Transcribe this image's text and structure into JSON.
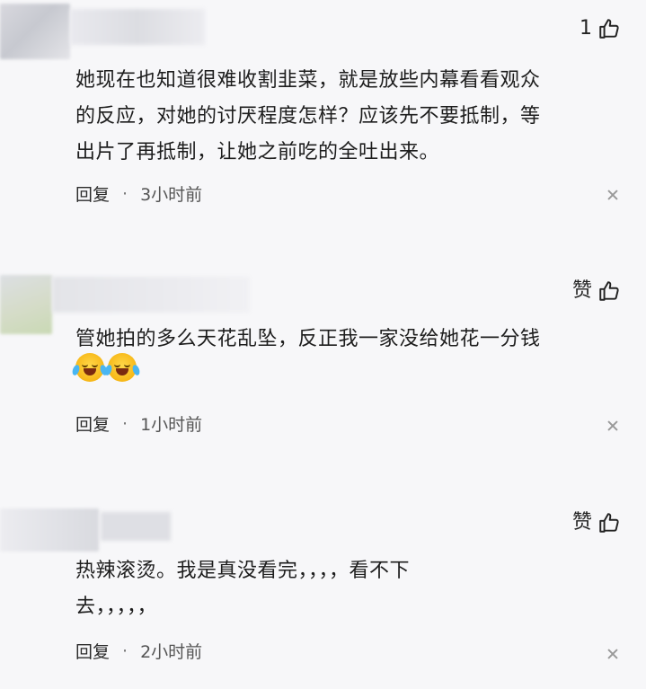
{
  "comments": [
    {
      "like_label": "1",
      "lines": [
        "她现在也知道很难收割韭菜，就是放些内幕看看观众",
        "的反应，对她的讨厌程度怎样？应该先不要抵制，等",
        "出片了再抵制，让她之前吃的全吐出来。"
      ],
      "reply_label": "回复",
      "separator": "·",
      "time": "3小时前"
    },
    {
      "like_label": "赞",
      "lines": [
        "管她拍的多么天花乱坠，反正我一家没给她花一分钱"
      ],
      "emojis": [
        "crying-laughing-emoji",
        "crying-laughing-emoji"
      ],
      "reply_label": "回复",
      "separator": "·",
      "time": "1小时前"
    },
    {
      "like_label": "赞",
      "lines": [
        "热辣滚烫。我是真没看完，，，，看不下",
        "去，，，，，"
      ],
      "reply_label": "回复",
      "separator": "·",
      "time": "2小时前"
    }
  ],
  "icons": {
    "like": "thumbs-up-icon",
    "close": "close-icon"
  }
}
